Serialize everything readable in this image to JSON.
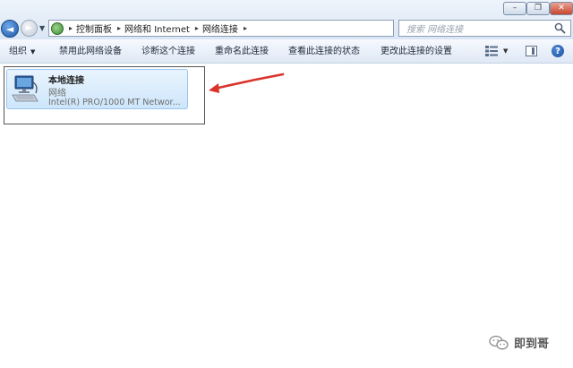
{
  "window": {
    "controls": {
      "minimize": "–",
      "maximize": "❐",
      "close": "✕"
    }
  },
  "nav": {
    "back": "◄",
    "forward": "►",
    "dropdown": "▼"
  },
  "address": {
    "breadcrumbs": [
      "控制面板",
      "网络和 Internet",
      "网络连接"
    ],
    "separator": "▸",
    "dropdown": "▼",
    "refresh": "↻"
  },
  "search": {
    "placeholder": "搜索 网络连接"
  },
  "toolbar": {
    "organize": "组织",
    "organize_arrow": "▼",
    "disable": "禁用此网络设备",
    "diagnose": "诊断这个连接",
    "rename": "重命名此连接",
    "status": "查看此连接的状态",
    "settings": "更改此连接的设置",
    "view_arrow": "▼",
    "help": "?"
  },
  "connection": {
    "name": "本地连接",
    "network": "网络",
    "device": "Intel(R) PRO/1000 MT Networ..."
  },
  "annotation": {
    "arrow_color": "#d9332b"
  },
  "watermark": {
    "text": "即到哥"
  },
  "colors": {
    "accent": "#1d58a8",
    "close_red": "#c7452e",
    "selection": "#cde6fb"
  }
}
